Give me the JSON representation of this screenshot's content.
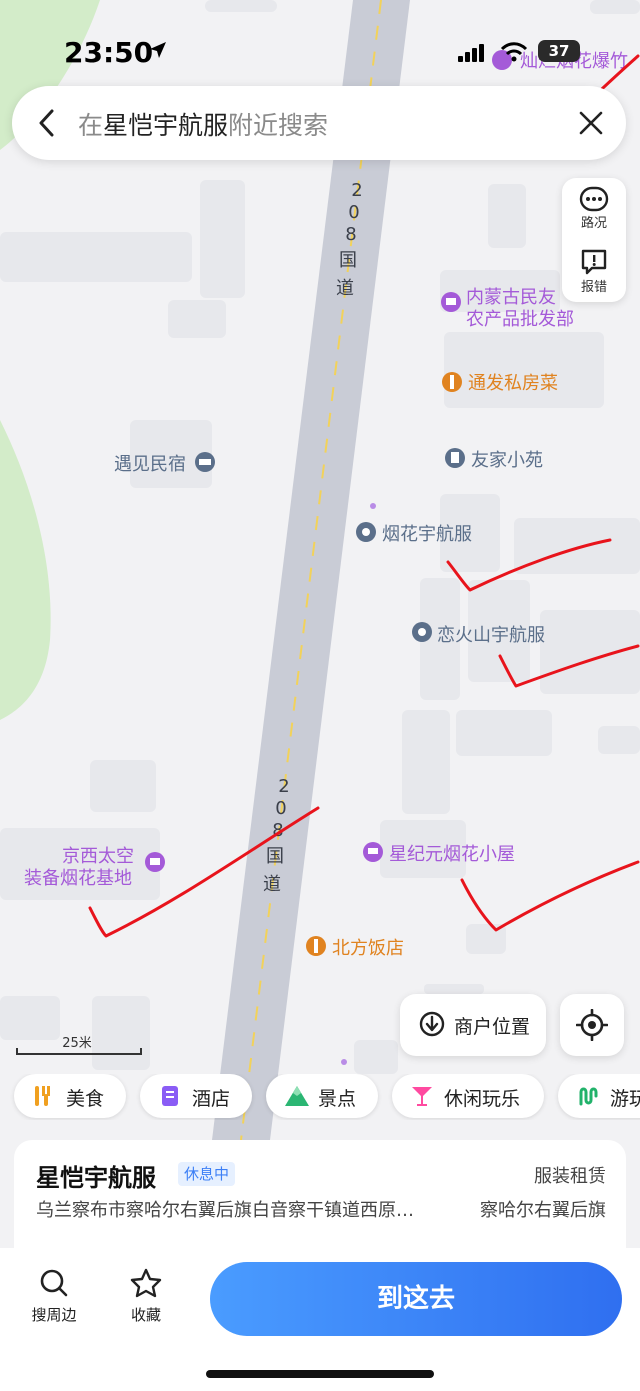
{
  "status": {
    "time": "23:50",
    "battery": "37"
  },
  "search": {
    "prefix": "在",
    "place": "星恺宇航服",
    "suffix": "附近搜索"
  },
  "tools": [
    {
      "label": "路况",
      "icon": "traffic-icon"
    },
    {
      "label": "报错",
      "icon": "report-icon"
    }
  ],
  "map": {
    "roads": [
      {
        "label": "208国道",
        "chars": [
          "2",
          "0",
          "8",
          "国",
          "道"
        ]
      }
    ],
    "pois": [
      {
        "name": "灿烂烟花爆竹",
        "color": "#a45ad8",
        "icon": "shop-icon"
      },
      {
        "name": "内蒙古民友",
        "name2": "农产品批发部",
        "color": "#a45ad8",
        "icon": "shop-icon"
      },
      {
        "name": "通发私房菜",
        "color": "#e08320",
        "icon": "food-icon"
      },
      {
        "name": "友家小苑",
        "color": "#5b6f8a",
        "icon": "building-icon"
      },
      {
        "name": "遇见民宿",
        "color": "#5b6f8a",
        "icon": "hotel-icon"
      },
      {
        "name": "烟花宇航服",
        "color": "#5b6f8a",
        "icon": "camera-icon"
      },
      {
        "name": "恋火山宇航服",
        "color": "#5b6f8a",
        "icon": "camera-icon"
      },
      {
        "name": "京西太空",
        "name2": "装备烟花基地",
        "color": "#a45ad8",
        "icon": "shop-icon"
      },
      {
        "name": "星纪元烟花小屋",
        "color": "#a45ad8",
        "icon": "cart-icon"
      },
      {
        "name": "北方饭店",
        "color": "#e08320",
        "icon": "food-icon"
      }
    ],
    "scale": "25米"
  },
  "buttons": {
    "merchant_location": "商户位置"
  },
  "categories": [
    {
      "label": "美食",
      "icon": "food-icon",
      "color": "#f0a020"
    },
    {
      "label": "酒店",
      "icon": "hotel-doc-icon",
      "color": "#8a5cf5"
    },
    {
      "label": "景点",
      "icon": "mountain-icon",
      "color": "#2bb673"
    },
    {
      "label": "休闲玩乐",
      "icon": "cocktail-icon",
      "color": "#ff4aa0"
    },
    {
      "label": "游玩",
      "icon": "route-icon",
      "color": "#21b26a"
    }
  ],
  "place": {
    "name": "星恺宇航服",
    "status": "休息中",
    "category": "服装租赁",
    "address": "乌兰察布市察哈尔右翼后旗白音察干镇道西原…",
    "district": "察哈尔右翼后旗"
  },
  "bottom": {
    "nearby": "搜周边",
    "favorite": "收藏",
    "go": "到这去"
  },
  "colors": {
    "accent": "#3a86ff",
    "annotation": "#e8141c"
  }
}
